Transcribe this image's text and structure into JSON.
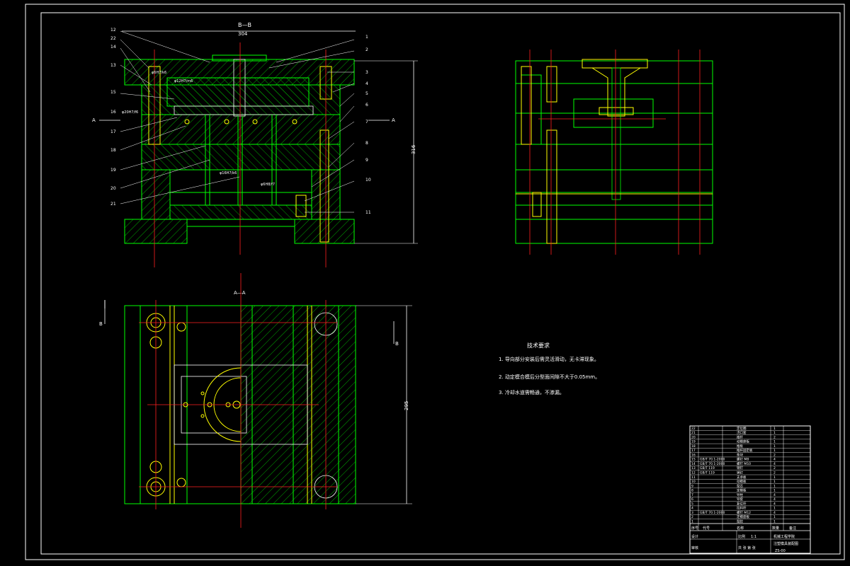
{
  "colors": {
    "background": "#000000",
    "frame": "#ffffff",
    "outline": "#00ff00",
    "centerline": "#ff2020",
    "pin": "#ffff00",
    "text": "#ffffff",
    "hatch": "#00cc00"
  },
  "views": {
    "section_bb_label": "B—B",
    "section_aa_label": "A—A",
    "width_dim": "304",
    "height_dim_top": "316",
    "height_dim_bottom": "295",
    "marker_b": "B",
    "marker_a": "A"
  },
  "callouts_left": [
    "12",
    "22",
    "14",
    "13",
    "15",
    "16",
    "17",
    "18",
    "19",
    "20",
    "21"
  ],
  "callouts_right": [
    "1",
    "2",
    "3",
    "4",
    "5",
    "6",
    "7",
    "8",
    "9",
    "10",
    "11"
  ],
  "section_notes": [
    "φ6H7/k6",
    "φ12H7/m6",
    "φ20H7/f6",
    "φ16H7/k6",
    "φ6H8/f7"
  ],
  "technical_requirements": {
    "title": "技术要求",
    "items": [
      "1.  导向部分安装后需灵活滑动，无卡滞现象。",
      "2.  动定模合模后分型面间隙不大于0.05mm。",
      "3.  冷却水道需畅通，不渗漏。"
    ]
  },
  "parts_table": {
    "rows": [
      [
        "22",
        "",
        "定位圈",
        "1",
        ""
      ],
      [
        "21",
        "",
        "浇口套",
        "1",
        ""
      ],
      [
        "20",
        "",
        "推杆",
        "2",
        ""
      ],
      [
        "19",
        "",
        "动模座板",
        "1",
        ""
      ],
      [
        "18",
        "",
        "推板",
        "1",
        ""
      ],
      [
        "17",
        "",
        "推杆固定板",
        "1",
        ""
      ],
      [
        "16",
        "",
        "垫块",
        "2",
        ""
      ],
      [
        "15",
        "GB/T 70.1-2000",
        "螺钉 M8",
        "4",
        ""
      ],
      [
        "14",
        "GB/T 70.1-2000",
        "螺钉 M10",
        "4",
        ""
      ],
      [
        "13",
        "GB/T 119",
        "销钉",
        "2",
        ""
      ],
      [
        "12",
        "GB/T 119",
        "销钉",
        "2",
        ""
      ],
      [
        "11",
        "",
        "支承板",
        "1",
        ""
      ],
      [
        "10",
        "",
        "动模板",
        "1",
        ""
      ],
      [
        "9",
        "",
        "型芯",
        "1",
        ""
      ],
      [
        "8",
        "",
        "定模板",
        "1",
        ""
      ],
      [
        "7",
        "",
        "导柱",
        "4",
        ""
      ],
      [
        "6",
        "",
        "导套",
        "4",
        ""
      ],
      [
        "5",
        "",
        "复位杆",
        "4",
        ""
      ],
      [
        "4",
        "",
        "拉料杆",
        "1",
        ""
      ],
      [
        "3",
        "GB/T 70.1-2000",
        "螺钉 M12",
        "4",
        ""
      ],
      [
        "2",
        "",
        "定模座板",
        "1",
        ""
      ],
      [
        "1",
        "",
        "型腔",
        "1",
        ""
      ]
    ],
    "header": [
      "序号",
      "代号",
      "名称",
      "数量",
      "备注"
    ],
    "title_block": {
      "school": "机械工程学院",
      "drawing_name": "注塑模具装配图",
      "scale_label": "比例",
      "scale": "1:1",
      "drawing_no": "ZS-00",
      "designer_label": "设计",
      "checker_label": "审核",
      "sheet_label": "共 张 第 张"
    }
  }
}
